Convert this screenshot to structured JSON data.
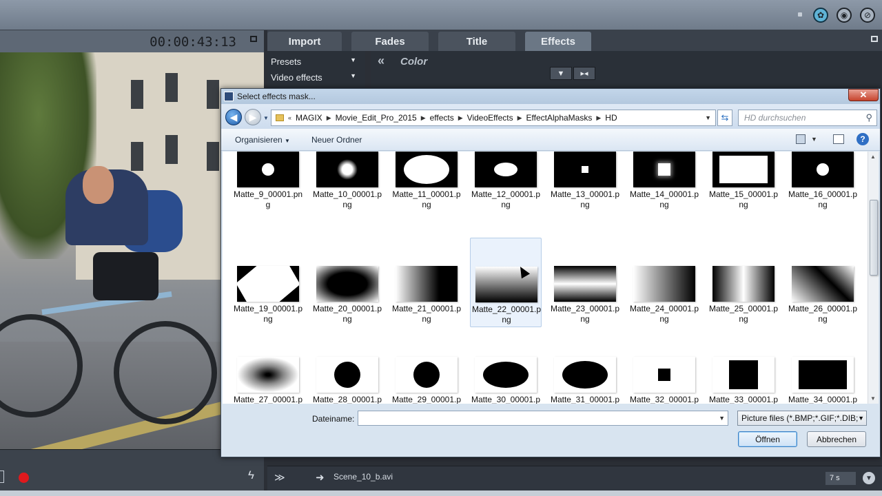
{
  "app": {
    "timecode": "00:00:43:13",
    "tabs": [
      "Import",
      "Fades",
      "Title",
      "Effects"
    ],
    "active_tab": "Effects",
    "side_panel": {
      "presets": "Presets",
      "video_effects": "Video effects"
    },
    "breadcrumb_label": "Color",
    "bottom": {
      "scene": "Scene_10_b.avi",
      "duration": "7 s"
    }
  },
  "dialog": {
    "title": "Select effects mask...",
    "close_label": "✕",
    "path": [
      "MAGIX",
      "Movie_Edit_Pro_2015",
      "effects",
      "VideoEffects",
      "EffectAlphaMasks",
      "HD"
    ],
    "search_placeholder": "HD durchsuchen",
    "toolbar": {
      "organize": "Organisieren",
      "new_folder": "Neuer Ordner"
    },
    "files": [
      {
        "name": "Matte_9_00001.png",
        "mask": "small-circle"
      },
      {
        "name": "Matte_10_00001.png",
        "mask": "soft-small-circle"
      },
      {
        "name": "Matte_11_00001.png",
        "mask": "large-ellipse"
      },
      {
        "name": "Matte_12_00001.png",
        "mask": "medium-ellipse"
      },
      {
        "name": "Matte_13_00001.png",
        "mask": "small-square"
      },
      {
        "name": "Matte_14_00001.png",
        "mask": "soft-small-square"
      },
      {
        "name": "Matte_15_00001.png",
        "mask": "large-rectangle"
      },
      {
        "name": "Matte_16_00001.png",
        "mask": "ring"
      },
      {
        "name": "Matte_19_00001.png",
        "mask": "diamond"
      },
      {
        "name": "Matte_20_00001.png",
        "mask": "soft-dark-ellipse"
      },
      {
        "name": "Matte_21_00001.png",
        "mask": "gradient-left-right"
      },
      {
        "name": "Matte_22_00001.png",
        "mask": "gradient-top-bottom"
      },
      {
        "name": "Matte_23_00001.png",
        "mask": "horizontal-band"
      },
      {
        "name": "Matte_24_00001.png",
        "mask": "gradient-right-dark"
      },
      {
        "name": "Matte_25_00001.png",
        "mask": "vertical-band"
      },
      {
        "name": "Matte_26_00001.png",
        "mask": "diagonal-gradient"
      },
      {
        "name": "Matte_27_00001.png",
        "mask": "star-blur"
      },
      {
        "name": "Matte_28_00001.png",
        "mask": "black-circle"
      },
      {
        "name": "Matte_29_00001.png",
        "mask": "black-circle-small"
      },
      {
        "name": "Matte_30_00001.png",
        "mask": "black-ellipse"
      },
      {
        "name": "Matte_31_00001.png",
        "mask": "black-ellipse-tall"
      },
      {
        "name": "Matte_32_00001.png",
        "mask": "black-small-square"
      },
      {
        "name": "Matte_33_00001.png",
        "mask": "black-square"
      },
      {
        "name": "Matte_34_00001.png",
        "mask": "black-rectangle"
      }
    ],
    "selected_file": "Matte_22_00001.png",
    "filename_label": "Dateiname:",
    "filename_value": "",
    "filter": "Picture files (*.BMP;*.GIF;*.DIB;*",
    "ok_label": "Öffnen",
    "cancel_label": "Abbrechen"
  }
}
